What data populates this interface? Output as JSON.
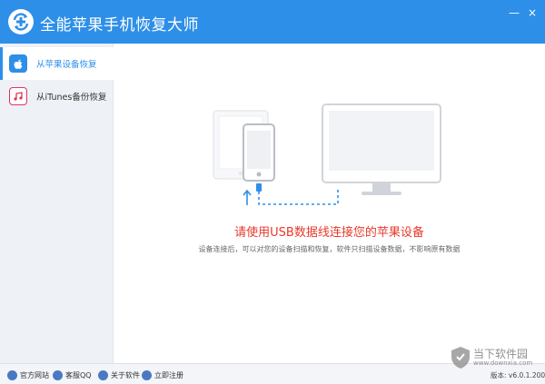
{
  "app": {
    "title": "全能苹果手机恢复大师"
  },
  "window": {
    "minimize": "—",
    "close": "×"
  },
  "sidebar": {
    "items": [
      {
        "label": "从苹果设备恢复",
        "icon": "apple-icon",
        "active": true
      },
      {
        "label": "从iTunes备份恢复",
        "icon": "itunes-music-icon",
        "active": false
      }
    ]
  },
  "main": {
    "message": "请使用USB数据线连接您的苹果设备",
    "description": "设备连接后，可以对您的设备扫描和恢复，软件只扫描设备数据，不影响原有数据"
  },
  "footer": {
    "links": [
      {
        "label": "官方网站",
        "icon": "home-icon"
      },
      {
        "label": "客服QQ",
        "icon": "qq-icon"
      },
      {
        "label": "关于软件",
        "icon": "info-icon"
      },
      {
        "label": "立即注册",
        "icon": "user-icon"
      }
    ],
    "version": "版本: v6.0.1.200"
  },
  "watermark": {
    "cn": "当下软件园",
    "en": "www.downxia.com"
  },
  "colors": {
    "accent": "#2e8fe8",
    "message": "#e8382b",
    "sidebar": "#eef2f6"
  }
}
